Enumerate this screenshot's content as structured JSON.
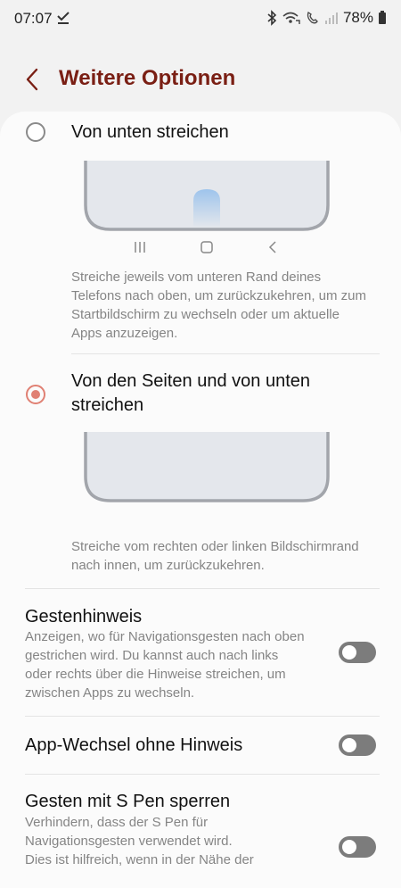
{
  "status": {
    "time": "07:07",
    "battery": "78%"
  },
  "header": {
    "title": "Weitere Optionen"
  },
  "options": [
    {
      "title": "Von unten streichen",
      "selected": false,
      "description": [
        "Streiche jeweils vom unteren Rand deines",
        "Telefons nach oben, um zurückzukehren, um zum",
        "Startbildschirm zu wechseln oder um aktuelle",
        "Apps anzuzeigen."
      ]
    },
    {
      "title_lines": [
        "Von den Seiten und von unten",
        "streichen"
      ],
      "selected": true,
      "description": [
        "Streiche vom rechten oder linken Bildschirmrand",
        "nach innen, um zurückzukehren."
      ]
    }
  ],
  "settings": [
    {
      "title": "Gestenhinweis",
      "description": [
        "Anzeigen, wo für Navigationsgesten nach oben",
        "gestrichen wird. Du kannst auch nach links",
        "oder rechts über die Hinweise streichen, um",
        "zwischen Apps zu wechseln."
      ],
      "enabled": false
    },
    {
      "title": "App-Wechsel ohne Hinweis",
      "enabled": false
    },
    {
      "title": "Gesten mit S Pen sperren",
      "description": [
        "Verhindern, dass der S Pen für",
        "Navigationsgesten verwendet wird.",
        "Dies ist hilfreich, wenn in der Nähe der"
      ],
      "enabled": false
    }
  ],
  "colors": {
    "accent": "#e08073",
    "title": "#7a1f14",
    "toggle_off": "#7c7c7c"
  }
}
